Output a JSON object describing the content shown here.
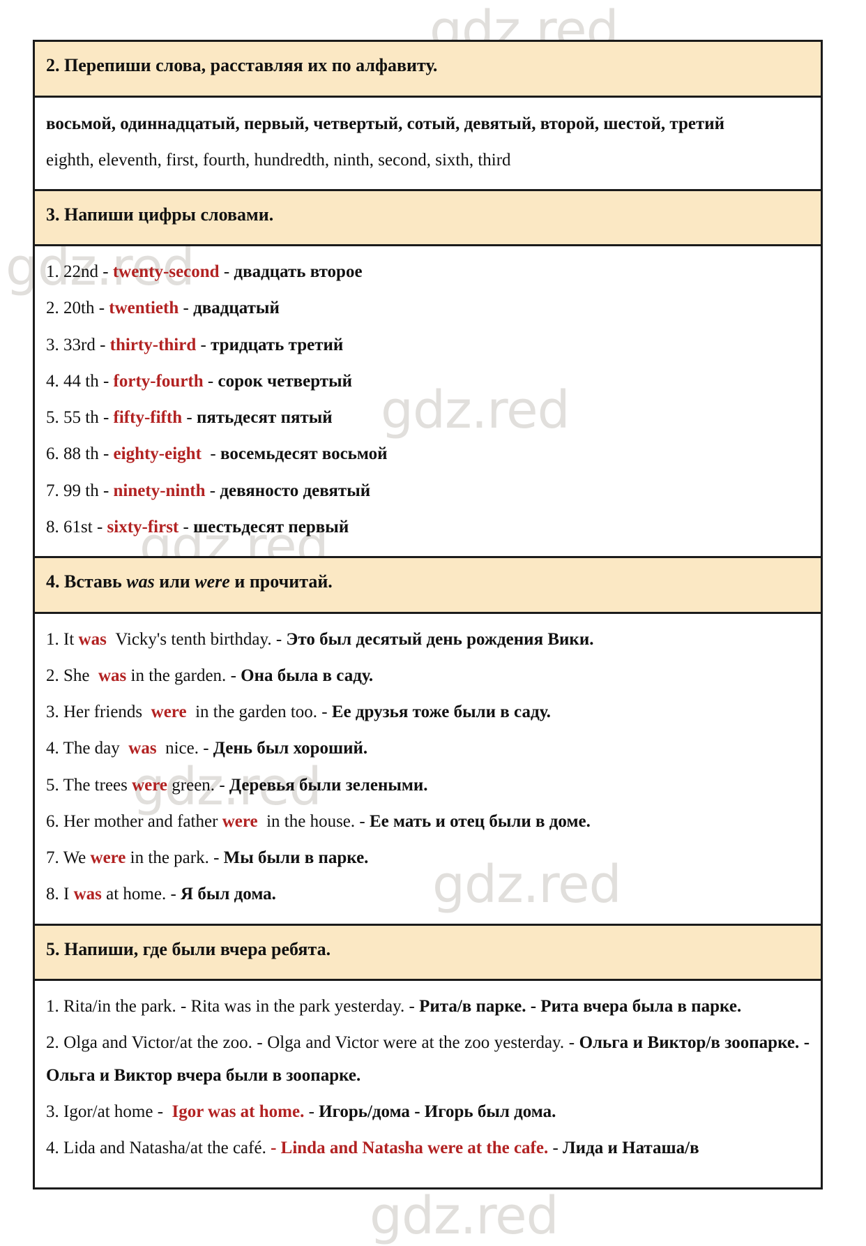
{
  "watermarks": [
    "gdz.red",
    "gdz.red",
    "gdz.red",
    "gdz.red",
    "gdz.red",
    "gdz.red",
    "gdz.red"
  ],
  "sections": [
    {
      "id": "exercise-2",
      "heading": "2. Перепиши слова, расставляя их по алфавиту.",
      "answer_ru": "восьмой, одиннадцатый, первый, четвертый, сотый, девятый, второй, шестой, третий",
      "answer_en": "eighth, eleventh, first, fourth, hundredth, ninth, second, sixth, third"
    },
    {
      "id": "exercise-3",
      "heading": "3. Напиши цифры словами.",
      "items": [
        {
          "num": "1.",
          "figure": "22nd",
          "dash1": "-",
          "answer": "twenty-second",
          "dash2": "-",
          "russian": "двадцать второе"
        },
        {
          "num": "2.",
          "figure": "20th",
          "dash1": "-",
          "answer": "twentieth",
          "dash2": "-",
          "russian": "двадцатый"
        },
        {
          "num": "3.",
          "figure": "33rd",
          "dash1": "-",
          "answer": "thirty-third",
          "dash2": "-",
          "russian": "тридцать третий"
        },
        {
          "num": "4.",
          "figure": "44 th",
          "dash1": "-",
          "answer": "forty-fourth",
          "dash2": "-",
          "russian": "сорок четвертый"
        },
        {
          "num": "5.",
          "figure": "55 th",
          "dash1": "-",
          "answer": "fifty-fifth",
          "dash2": "-",
          "russian": "пятьдесят пятый"
        },
        {
          "num": "6.",
          "figure": "88 th",
          "dash1": "-",
          "answer": "eighty-eight",
          "dash2": "-",
          "russian": "восемьдесят восьмой"
        },
        {
          "num": "7.",
          "figure": "99 th",
          "dash1": "-",
          "answer": "ninety-ninth",
          "dash2": "-",
          "russian": "девяносто девятый"
        },
        {
          "num": "8.",
          "figure": "61st",
          "dash1": "-",
          "answer": "sixty-first",
          "dash2": "-",
          "russian": "шестьдесят первый"
        }
      ]
    },
    {
      "id": "exercise-4",
      "heading_parts": {
        "p1": "4. Вставь ",
        "i1": "was",
        "p2": " или ",
        "i2": "were",
        "p3": " и прочитай."
      },
      "items": [
        {
          "num": "1.",
          "before": "It",
          "answer": "was",
          "after": "Vicky's tenth birthday.",
          "dash": "-",
          "russian": "Это был десятый день рождения Вики."
        },
        {
          "num": "2.",
          "before": "She",
          "answer": "was",
          "after": "in the garden.",
          "dash": "-",
          "russian": "Она была в саду."
        },
        {
          "num": "3.",
          "before": "Her friends",
          "answer": "were",
          "after": "in the garden too.",
          "dash": "-",
          "russian": "Ее друзья тоже были в саду."
        },
        {
          "num": "4.",
          "before": "The day",
          "answer": "was",
          "after": "nice.",
          "dash": "-",
          "russian": "День был хороший."
        },
        {
          "num": "5.",
          "before": "The trees",
          "answer": "were",
          "after": "green.",
          "dash": "-",
          "russian": "Деревья были зелеными."
        },
        {
          "num": "6.",
          "before": "Her mother and father",
          "answer": "were",
          "after": "in the house.",
          "dash": "-",
          "russian": "Ее мать и отец были в доме."
        },
        {
          "num": "7.",
          "before": "We",
          "answer": "were",
          "after": "in the park.",
          "dash": "-",
          "russian": "Мы были в парке."
        },
        {
          "num": "8.",
          "before": "I",
          "answer": "was",
          "after": "at home.",
          "dash": "-",
          "russian": "Я был дома."
        }
      ]
    },
    {
      "id": "exercise-5",
      "heading": "5. Напиши, где были вчера ребята.",
      "items": [
        {
          "num": "1.",
          "prompt": "Rita/in the park.",
          "dash1": "-",
          "answer_plain": "Rita was in the park yesterday.",
          "dash2": "-",
          "russian_prompt": "Рита/в парке.",
          "dash3": "-",
          "russian_answer": "Рита вчера была в парке.",
          "answer_is_red": false
        },
        {
          "num": "2.",
          "prompt": "Olga and Victor/at the zoo.",
          "dash1": "-",
          "answer_plain": "Olga and Victor were at the zoo yesterday.",
          "dash2": "-",
          "russian_prompt": "Ольга и Виктор/в зоопарке.",
          "dash3": "-",
          "russian_answer": "Ольга и Виктор вчера были в зоопарке.",
          "answer_is_red": false
        },
        {
          "num": "3.",
          "prompt": "Igor/at home",
          "dash1": "-",
          "answer_plain": "Igor was at home.",
          "dash2": "-",
          "russian_prompt": "Игорь/дома",
          "dash3": "-",
          "russian_answer": "Игорь был дома.",
          "answer_is_red": true
        },
        {
          "num": "4.",
          "prompt": "Lida and Natasha/at the café.",
          "dash1": "-",
          "answer_plain": "Linda and Natasha were at the cafe.",
          "dash2": "-",
          "russian_prompt": "Лида и Наташа/в",
          "dash3": "",
          "russian_answer": "",
          "answer_is_red": true
        }
      ]
    }
  ],
  "colors": {
    "header_bg": "#fbe8c4",
    "answer_red": "#b22222",
    "border": "#1b1b1b",
    "watermark": "#c9c6c0"
  }
}
